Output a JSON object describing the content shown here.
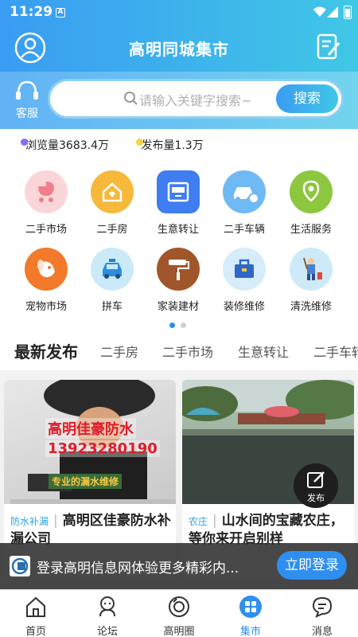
{
  "status": {
    "time": "11:29",
    "a_label": "A"
  },
  "header": {
    "title": "高明同城集市"
  },
  "search": {
    "kefu_label": "客服",
    "placeholder": "请输入关键字搜索~",
    "button_label": "搜索"
  },
  "stats": [
    {
      "label": "浏览量3683.4万",
      "color": "#8a6cf0"
    },
    {
      "label": "发布量1.3万",
      "color": "#f6d43a"
    }
  ],
  "categories": [
    {
      "label": "二手市场",
      "icon": "baby-stroller-icon",
      "color": "#fbd6d8"
    },
    {
      "label": "二手房",
      "icon": "house-icon",
      "color": "#f7b93c"
    },
    {
      "label": "生意转让",
      "icon": "shop-icon",
      "color": "#3f7df0"
    },
    {
      "label": "二手车辆",
      "icon": "car-icon",
      "color": "#6fb9f5"
    },
    {
      "label": "生活服务",
      "icon": "location-pin-icon",
      "color": "#8dc63f"
    },
    {
      "label": "宠物市场",
      "icon": "dog-icon",
      "color": "#f27a2a"
    },
    {
      "label": "拼车",
      "icon": "taxi-icon",
      "color": "#cbeaf7"
    },
    {
      "label": "家装建材",
      "icon": "paint-roller-icon",
      "color": "#a0562a"
    },
    {
      "label": "装修维修",
      "icon": "toolbox-icon",
      "color": "#d7ecfa"
    },
    {
      "label": "清洗维修",
      "icon": "cleaner-icon",
      "color": "#cdeaf8"
    }
  ],
  "pager": {
    "active_color": "#2e8ff0",
    "inactive_color": "#cfcfcf"
  },
  "tabs": [
    "最新发布",
    "二手房",
    "二手市场",
    "生意转让",
    "二手车转"
  ],
  "cards": [
    {
      "tag": "防水补漏",
      "title": "高明区佳豪防水补漏公司",
      "img_text1": "高明佳豪防水",
      "img_text2": "13923280190",
      "img_text3": "专业的漏水维修"
    },
    {
      "tag": "农庄",
      "title": "山水间的宝藏农庄，等你来开启别样"
    }
  ],
  "fab": {
    "label": "发布"
  },
  "banner": {
    "text": "登录高明信息网体验更多精彩内...",
    "button_label": "立即登录"
  },
  "bottom_nav": [
    "首页",
    "论坛",
    "高明圈",
    "集市",
    "消息"
  ],
  "colors": {
    "brand_start": "#3a9cf2",
    "brand_end": "#40c7e6",
    "accent": "#2e8ff0"
  }
}
